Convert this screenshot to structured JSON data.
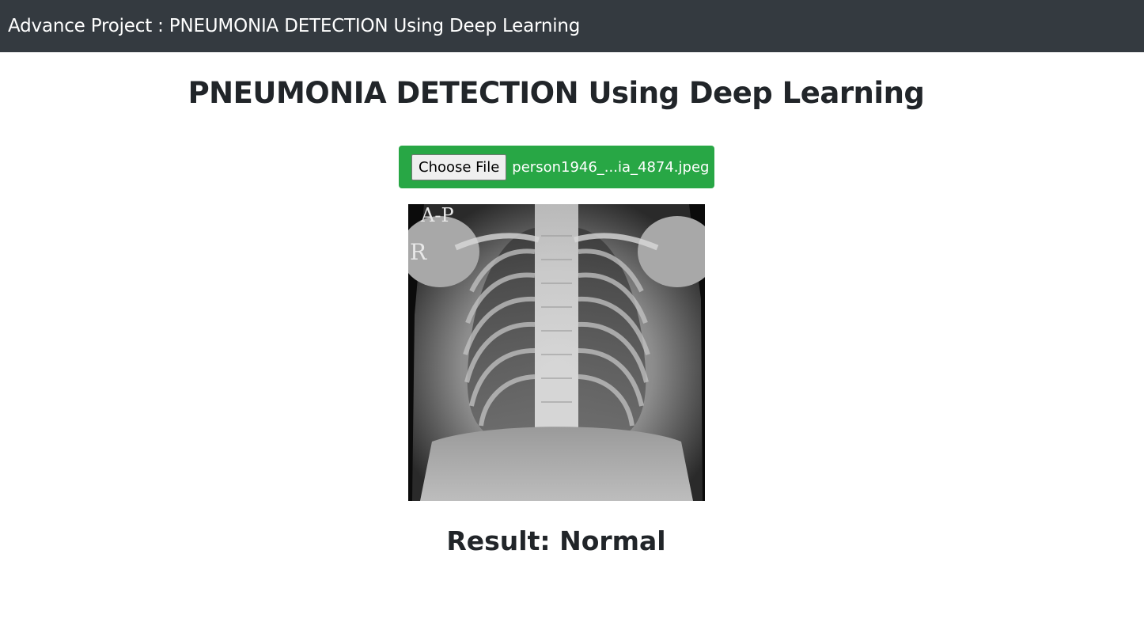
{
  "navbar": {
    "brand": "Advance Project : PNEUMONIA DETECTION Using Deep Learning"
  },
  "main": {
    "heading": "PNEUMONIA DETECTION Using Deep Learning",
    "upload": {
      "button_label": "Choose File",
      "file_name": "person1946_...ia_4874.jpeg"
    },
    "image": {
      "alt": "chest x-ray",
      "markers": [
        "A-P",
        "R"
      ]
    },
    "result": "Result: Normal"
  },
  "colors": {
    "navbar_bg": "#343a40",
    "upload_bg": "#28a745",
    "text": "#212529"
  }
}
